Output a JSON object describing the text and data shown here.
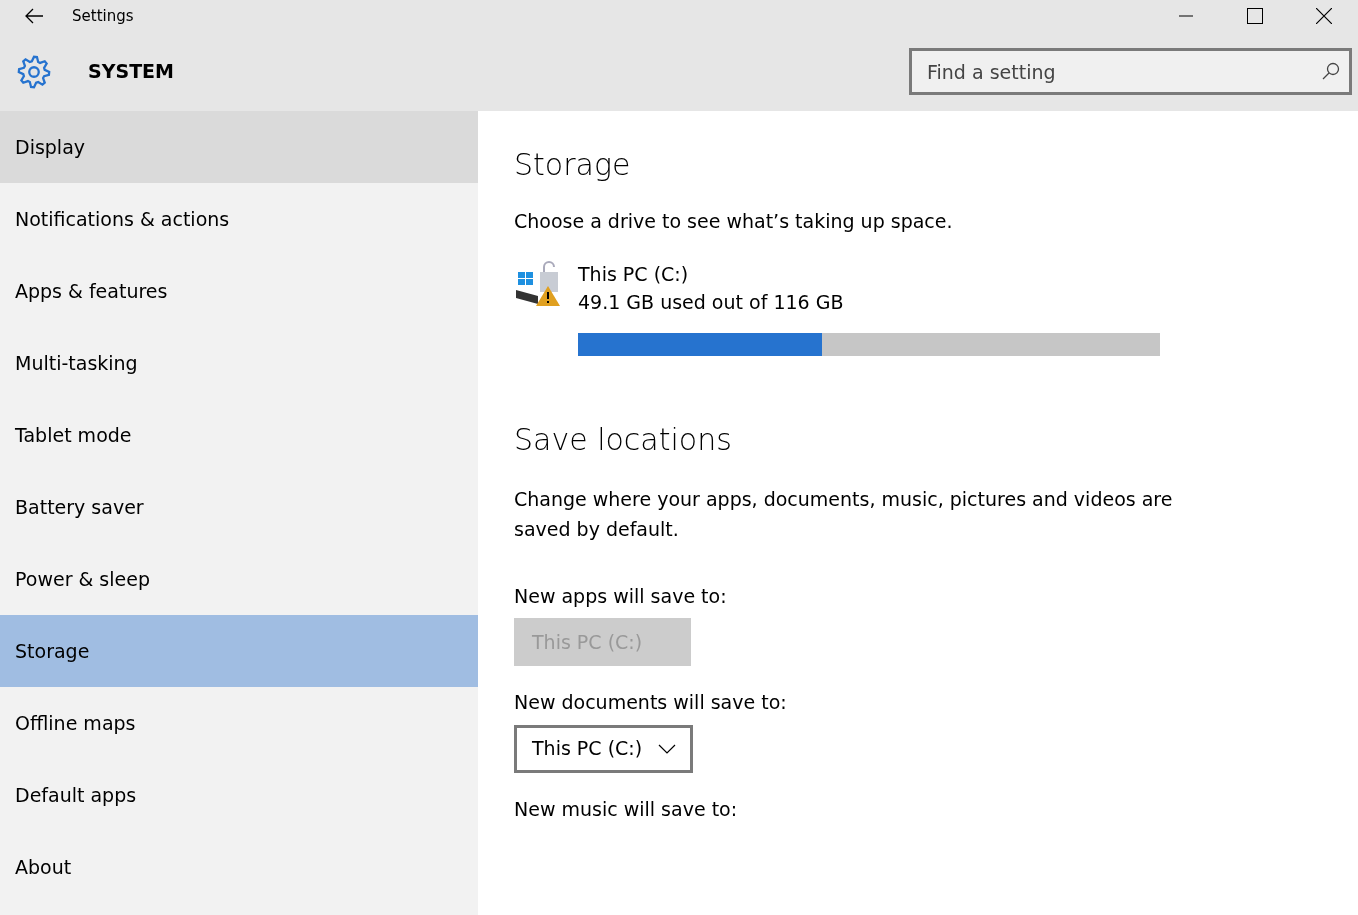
{
  "window": {
    "title": "Settings"
  },
  "header": {
    "title": "SYSTEM",
    "search": {
      "placeholder": "Find a setting"
    }
  },
  "sidebar": {
    "items": [
      {
        "label": "Display",
        "selected": false,
        "hover": true
      },
      {
        "label": "Notifications & actions",
        "selected": false,
        "hover": false
      },
      {
        "label": "Apps & features",
        "selected": false,
        "hover": false
      },
      {
        "label": "Multi-tasking",
        "selected": false,
        "hover": false
      },
      {
        "label": "Tablet mode",
        "selected": false,
        "hover": false
      },
      {
        "label": "Battery saver",
        "selected": false,
        "hover": false
      },
      {
        "label": "Power & sleep",
        "selected": false,
        "hover": false
      },
      {
        "label": "Storage",
        "selected": true,
        "hover": false
      },
      {
        "label": "Offline maps",
        "selected": false,
        "hover": false
      },
      {
        "label": "Default apps",
        "selected": false,
        "hover": false
      },
      {
        "label": "About",
        "selected": false,
        "hover": false
      }
    ]
  },
  "storage": {
    "heading": "Storage",
    "description": "Choose a drive to see what’s taking up space.",
    "drives": [
      {
        "name": "This PC (C:)",
        "usage": "49.1 GB used out of 116 GB",
        "level": 0.42
      }
    ]
  },
  "save_locations": {
    "heading": "Save locations",
    "description": "Change where your apps, documents, music, pictures and videos are saved by default.",
    "settings": [
      {
        "label": "New apps will save to:",
        "value": "This PC (C:)",
        "disabled": true
      },
      {
        "label": "New documents will save to:",
        "value": "This PC (C:)",
        "disabled": false
      },
      {
        "label": "New music will save to:"
      }
    ]
  }
}
